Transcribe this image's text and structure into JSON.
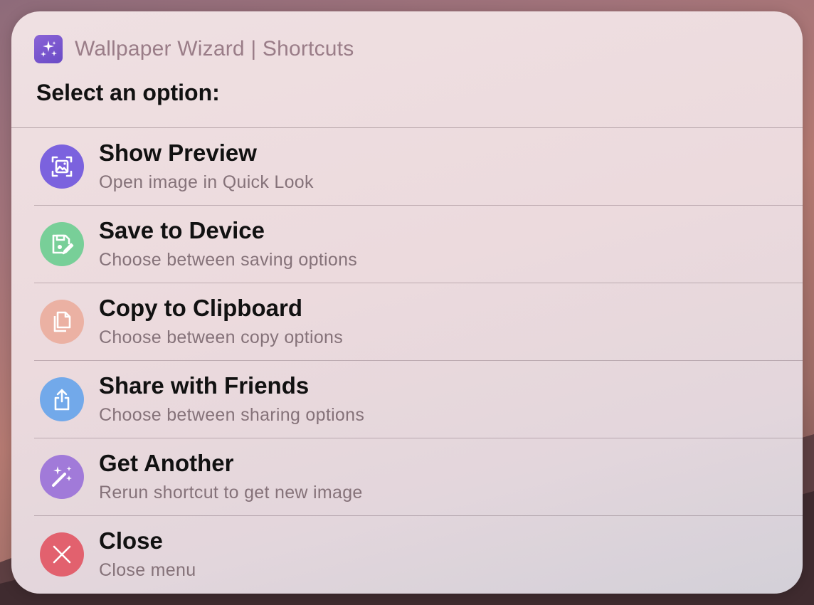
{
  "colors": {
    "sheet_background": "#ecdadd",
    "title_text": "#111111",
    "subtitle_text": "#857279",
    "header_text": "#9a7d88",
    "app_icon": "#7a58cf"
  },
  "header": {
    "app_icon": "magic-sparkles-icon",
    "title": "Wallpaper Wizard | Shortcuts"
  },
  "prompt": "Select an option:",
  "options": [
    {
      "title": "Show Preview",
      "subtitle": "Open image in Quick Look",
      "icon": "image-preview-icon",
      "color": "#7b62de"
    },
    {
      "title": "Save to Device",
      "subtitle": "Choose between saving options",
      "icon": "save-edit-icon",
      "color": "#78cf98"
    },
    {
      "title": "Copy to Clipboard",
      "subtitle": "Choose between copy options",
      "icon": "copy-documents-icon",
      "color": "#ebb1a3"
    },
    {
      "title": "Share with Friends",
      "subtitle": "Choose between sharing options",
      "icon": "share-icon",
      "color": "#72a9ea"
    },
    {
      "title": "Get Another",
      "subtitle": "Rerun shortcut to get new image",
      "icon": "magic-wand-icon",
      "color": "#a17ad9"
    },
    {
      "title": "Close",
      "subtitle": "Close menu",
      "icon": "close-x-icon",
      "color": "#e2616e"
    }
  ]
}
